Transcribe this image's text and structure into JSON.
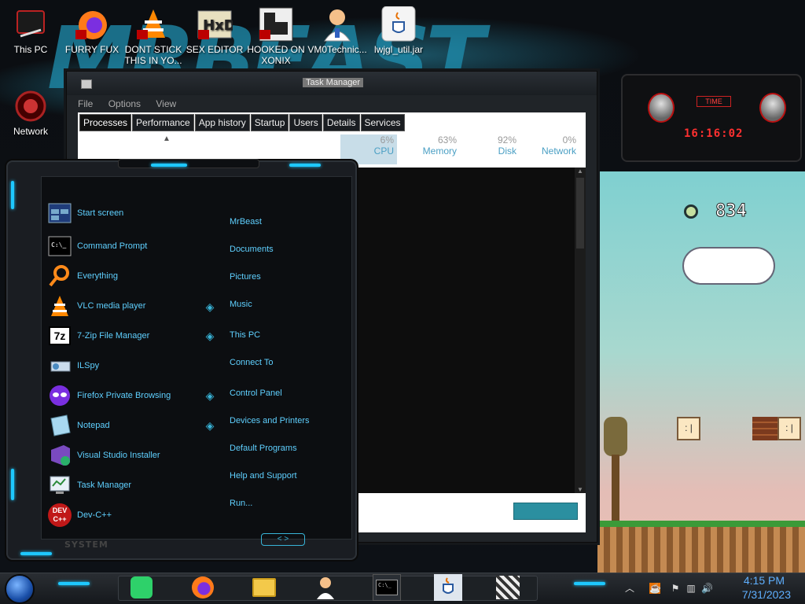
{
  "desktop": {
    "wallpaper_text": "MRBEAST",
    "icons": [
      {
        "label": "This PC",
        "icon": "this-pc-icon"
      },
      {
        "label": "FURRY FUX",
        "icon": "firefox-shortcut-icon"
      },
      {
        "label": "DONT STICK THIS IN YO...",
        "icon": "vlc-shortcut-icon"
      },
      {
        "label": "SEX EDITOR",
        "icon": "hxd-shortcut-icon"
      },
      {
        "label": "HOOKED ON XONIX",
        "icon": "xonix-shortcut-icon"
      },
      {
        "label": "VM0Technic...",
        "icon": "vm-technician-icon"
      },
      {
        "label": "lwjgl_util.jar",
        "icon": "java-jar-icon"
      },
      {
        "label": "Network",
        "icon": "network-icon"
      }
    ]
  },
  "task_manager": {
    "title": "Task Manager",
    "menu": [
      "File",
      "Options",
      "View"
    ],
    "tabs": [
      "Processes",
      "Performance",
      "App history",
      "Startup",
      "Users",
      "Details",
      "Services"
    ],
    "active_tab": "Processes",
    "columns": [
      {
        "pct": "6%",
        "name": "CPU"
      },
      {
        "pct": "63%",
        "name": "Memory"
      },
      {
        "pct": "92%",
        "name": "Disk"
      },
      {
        "pct": "0%",
        "name": "Network"
      }
    ]
  },
  "gadget": {
    "label": "TIME",
    "time": "16:16:02"
  },
  "game": {
    "score": "834"
  },
  "start_menu": {
    "left_items": [
      {
        "label": "Start screen",
        "icon": "start-screen-icon"
      },
      {
        "label": "Command Prompt",
        "icon": "command-prompt-icon"
      },
      {
        "label": "Everything",
        "icon": "magnifier-icon"
      },
      {
        "label": "VLC media player",
        "icon": "vlc-icon"
      },
      {
        "label": "7-Zip File Manager",
        "icon": "7zip-icon"
      },
      {
        "label": "ILSpy",
        "icon": "ilspy-icon"
      },
      {
        "label": "Firefox Private Browsing",
        "icon": "firefox-private-icon"
      },
      {
        "label": "Notepad",
        "icon": "notepad-icon"
      },
      {
        "label": "Visual Studio Installer",
        "icon": "visual-studio-installer-icon"
      },
      {
        "label": "Task Manager",
        "icon": "task-manager-icon"
      },
      {
        "label": "Dev-C++",
        "icon": "devcpp-icon"
      }
    ],
    "right_items": [
      "MrBeast",
      "Documents",
      "Pictures",
      "Music",
      "This PC",
      "Connect To",
      "Control Panel",
      "Devices and Printers",
      "Default Programs",
      "Help and Support",
      "Run..."
    ],
    "system_label": "SYSTEM",
    "power_label": "<  >"
  },
  "taskbar": {
    "pinned": [
      "spotify-icon",
      "firefox-icon",
      "file-explorer-icon",
      "technician-icon",
      "command-prompt-icon",
      "java-icon",
      "game-icon"
    ],
    "tray_icons": [
      "up-arrow-icon",
      "java-update-icon",
      "action-center-flag-icon",
      "network-icon",
      "volume-icon"
    ],
    "time": "4:15 PM",
    "date": "7/31/2023"
  },
  "colors": {
    "accent_cyan": "#1ec8ff",
    "menu_text": "#5fd0ff",
    "clock_red": "#ff3030"
  }
}
